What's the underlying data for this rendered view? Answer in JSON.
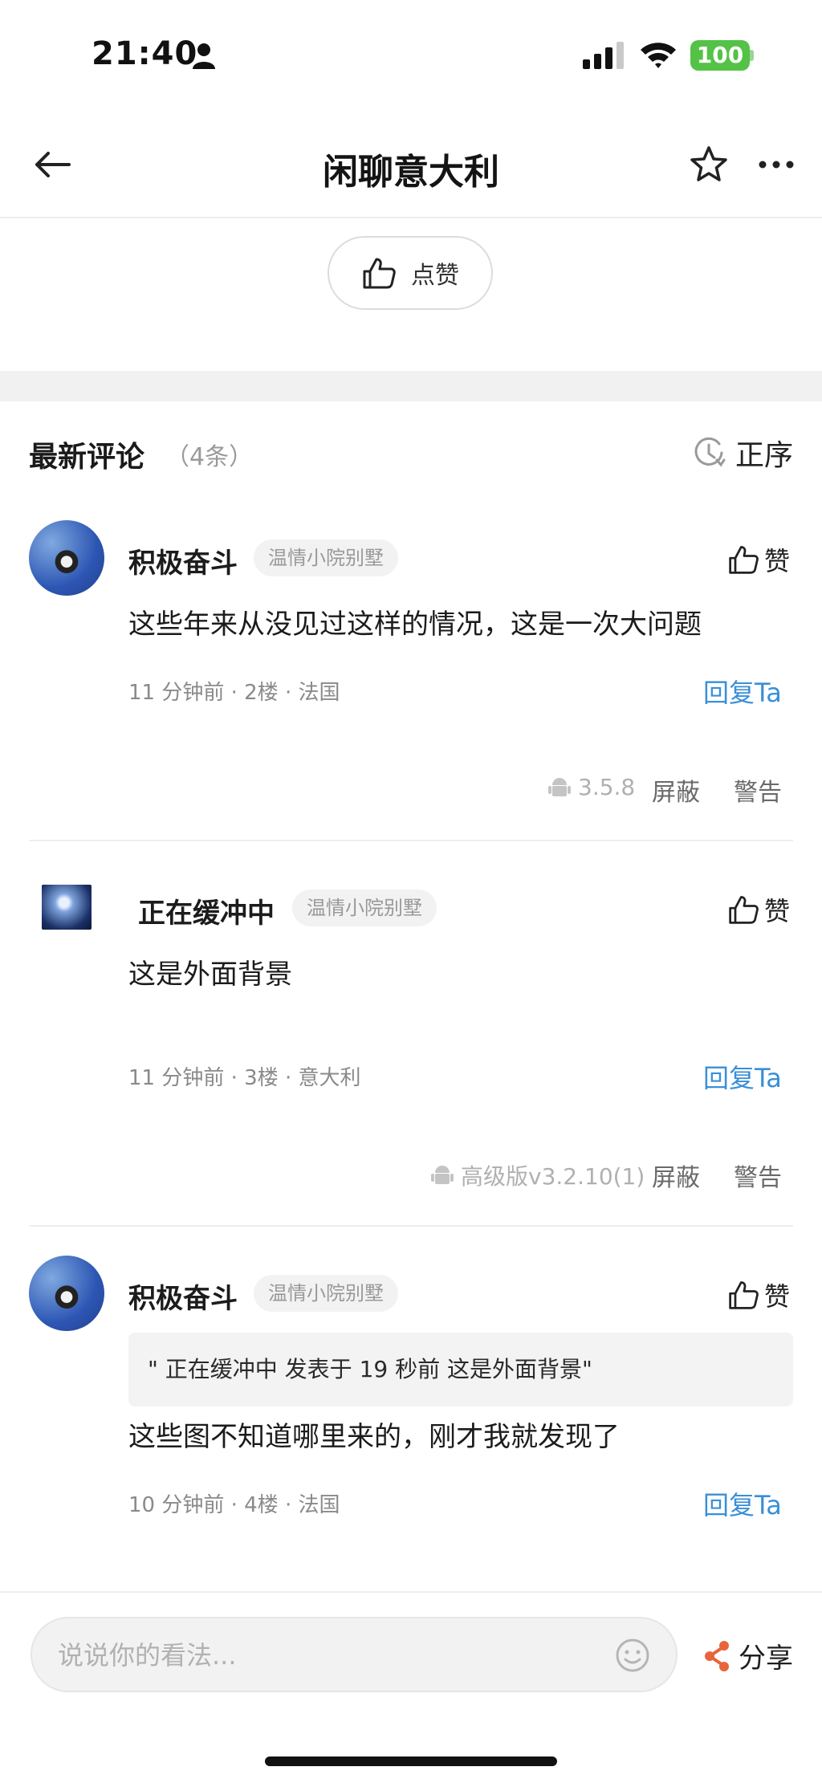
{
  "status_bar": {
    "time": "21:40",
    "battery": "100"
  },
  "header": {
    "title": "闲聊意大利"
  },
  "article_like": {
    "label": "点赞"
  },
  "comments_section": {
    "title": "最新评论",
    "count": "（4条）",
    "sort_label": "正序"
  },
  "comments": [
    {
      "username": "积极奋斗",
      "group": "温情小院别墅",
      "like_label": "赞",
      "text": "这些年来从没见过这样的情况，这是一次大问题",
      "meta": "11 分钟前 · 2楼 · 法国",
      "reply": "回复Ta",
      "device": "3.5.8",
      "block": "屏蔽",
      "report": "警告"
    },
    {
      "username": "正在缓冲中",
      "group": "温情小院别墅",
      "like_label": "赞",
      "text": "这是外面背景",
      "meta": "11 分钟前 · 3楼 · 意大利",
      "reply": "回复Ta",
      "device": "高级版v3.2.10(1)",
      "block": "屏蔽",
      "report": "警告"
    },
    {
      "username": "积极奋斗",
      "group": "温情小院别墅",
      "like_label": "赞",
      "quote": "\" 正在缓冲中 发表于 19 秒前 这是外面背景\"",
      "text": "这些图不知道哪里来的，刚才我就发现了",
      "meta": "10 分钟前 · 4楼 · 法国",
      "reply": "回复Ta"
    }
  ],
  "bottom_bar": {
    "input_placeholder": "说说你的看法...",
    "share_label": "分享"
  },
  "colors": {
    "accent_blue": "#3a8fd8",
    "battery_green": "#54c247",
    "share_orange": "#e8643c"
  }
}
